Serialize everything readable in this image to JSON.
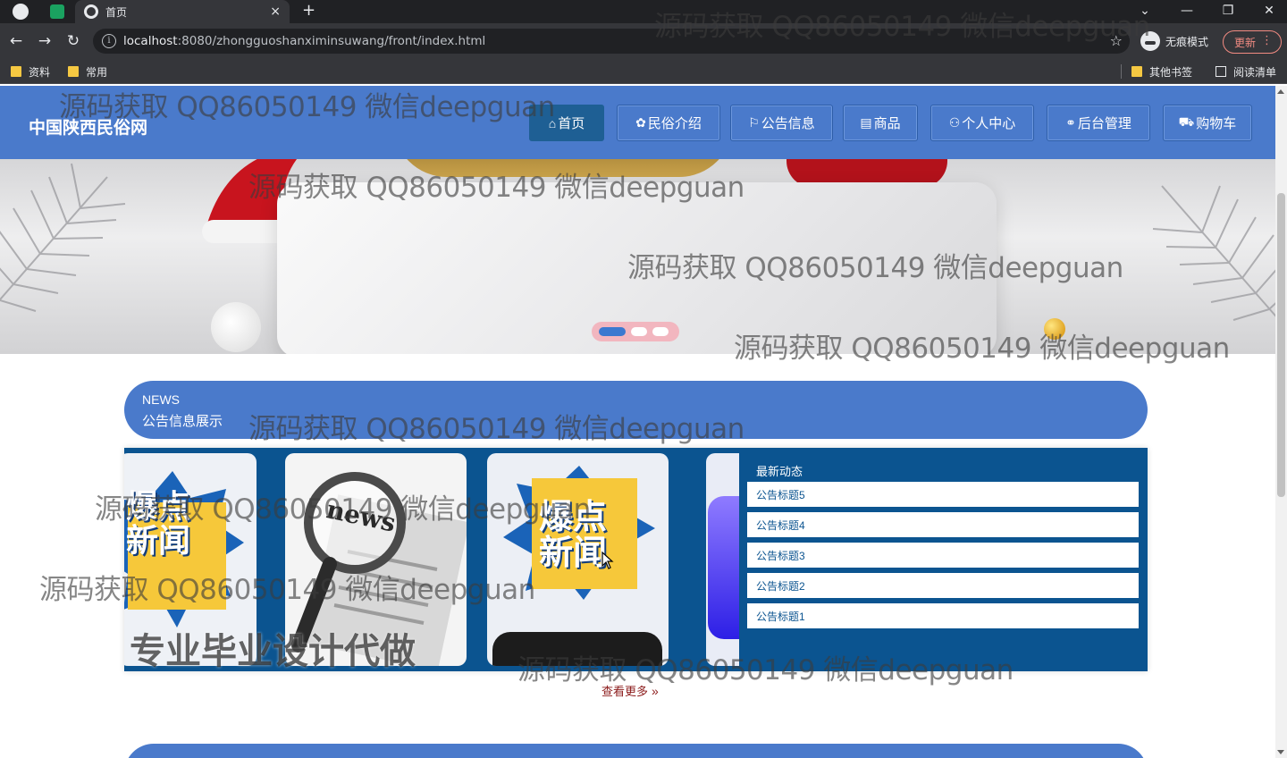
{
  "browser": {
    "tab_title": "首页",
    "new_tab_symbol": "+",
    "close_symbol": "×",
    "url_host": "localhost",
    "url_rest": ":8080/zhongguoshanximinsuwang/front/index.html",
    "incognito_label": "无痕模式",
    "update_label": "更新",
    "bookmarks": [
      "资料",
      "常用"
    ],
    "other_bookmarks": "其他书签",
    "reading_list": "阅读清单"
  },
  "site": {
    "title": "中国陕西民俗网",
    "nav": [
      {
        "label": "首页",
        "icon": "home-icon",
        "glyph": "⌂"
      },
      {
        "label": "民俗介绍",
        "icon": "palette-icon",
        "glyph": "✿"
      },
      {
        "label": "公告信息",
        "icon": "flag-icon",
        "glyph": "⚐"
      },
      {
        "label": "商品",
        "icon": "list-icon",
        "glyph": "▤"
      },
      {
        "label": "个人中心",
        "icon": "user-icon",
        "glyph": "⚇"
      },
      {
        "label": "后台管理",
        "icon": "link-icon",
        "glyph": "⚭"
      },
      {
        "label": "购物车",
        "icon": "cart-icon",
        "glyph": "⛟"
      }
    ],
    "active_nav": "首页",
    "carousel": {
      "slides": 3,
      "active_index": 0
    }
  },
  "news": {
    "heading_en": "NEWS",
    "heading_cn": "公告信息展示",
    "latest_title": "最新动态",
    "items": [
      "公告标题5",
      "公告标题4",
      "公告标题3",
      "公告标题2",
      "公告标题1"
    ],
    "card_texts": {
      "burst_line1": "爆点",
      "burst_line2": "新闻",
      "news_word": "news"
    },
    "more_label": "查看更多",
    "more_icon": "double-chevron-right-icon"
  },
  "overlay": {
    "watermark": "源码获取 QQ86050149 微信deepguan",
    "promo": "专业毕业设计代做"
  },
  "colors": {
    "header_blue": "#4a7acb",
    "panel_navy": "#0b5490",
    "active_nav": "#1e5f94",
    "more_link": "#8b1a1a"
  }
}
